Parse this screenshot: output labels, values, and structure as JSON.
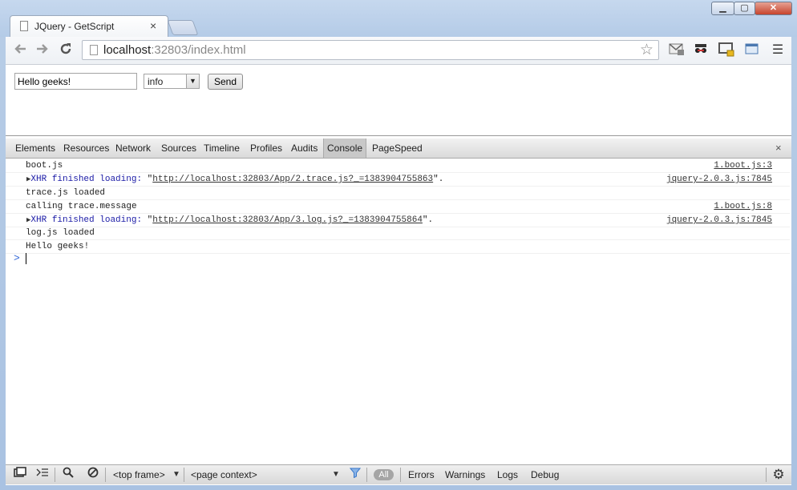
{
  "browser": {
    "tab_title": "JQuery - GetScript",
    "tab_close": "×",
    "url_host": "localhost",
    "url_rest": ":32803/index.html",
    "window_controls": {
      "minimize": "▁",
      "maximize": "▢",
      "close": "✕"
    }
  },
  "page": {
    "message_input_value": "Hello geeks!",
    "level_select_value": "info",
    "send_label": "Send"
  },
  "devtools": {
    "tabs": [
      "Elements",
      "Resources",
      "Network",
      "Sources",
      "Timeline",
      "Profiles",
      "Audits",
      "Console",
      "PageSpeed"
    ],
    "active_tab": "Console",
    "close": "×",
    "console_lines": [
      {
        "text": "boot.js",
        "source": "1.boot.js:3"
      },
      {
        "prefix": "XHR finished loading: ",
        "link": "http://localhost:32803/App/2.trace.js?_=1383904755863",
        "suffix": ".",
        "source": "jquery-2.0.3.js:7845"
      },
      {
        "text": "trace.js loaded",
        "source": ""
      },
      {
        "text": "calling trace.message",
        "source": "1.boot.js:8"
      },
      {
        "prefix": "XHR finished loading: ",
        "link": "http://localhost:32803/App/3.log.js?_=1383904755864",
        "suffix": ".",
        "source": "jquery-2.0.3.js:7845"
      },
      {
        "text": "log.js loaded",
        "source": ""
      },
      {
        "text": "Hello geeks!",
        "source": ""
      }
    ],
    "prompt_symbol": ">",
    "status_bar": {
      "frame": "<top frame>",
      "context": "<page context>",
      "filters": [
        "All",
        "Errors",
        "Warnings",
        "Logs",
        "Debug"
      ]
    }
  },
  "icons": {
    "back": "arrow-left-icon",
    "forward": "arrow-right-icon",
    "reload": "reload-icon",
    "star": "star-icon",
    "settings": "gear-icon"
  },
  "colors": {
    "xhr_blue": "#1a1aa6",
    "prompt_blue": "#3367d6",
    "window_frame": "#b4cbe7"
  }
}
